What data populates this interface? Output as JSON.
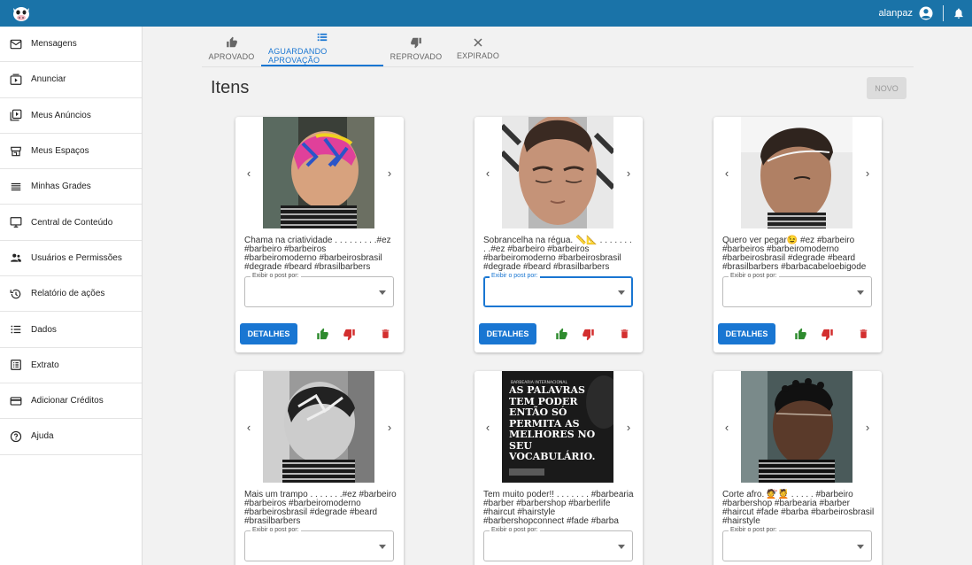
{
  "header": {
    "username": "alanpaz",
    "brand_color": "#1a73a8"
  },
  "sidebar": {
    "items": [
      {
        "label": "Mensagens",
        "icon": "mail-icon"
      },
      {
        "label": "Anunciar",
        "icon": "play-folder-icon"
      },
      {
        "label": "Meus Anúncios",
        "icon": "video-library-icon"
      },
      {
        "label": "Meus Espaços",
        "icon": "store-icon"
      },
      {
        "label": "Minhas Grades",
        "icon": "list-lines-icon"
      },
      {
        "label": "Central de Conteúdo",
        "icon": "monitor-icon"
      },
      {
        "label": "Usuários e Permissões",
        "icon": "users-icon"
      },
      {
        "label": "Relatório de ações",
        "icon": "history-icon"
      },
      {
        "label": "Dados",
        "icon": "bullet-list-icon"
      },
      {
        "label": "Extrato",
        "icon": "receipt-icon"
      },
      {
        "label": "Adicionar Créditos",
        "icon": "credit-card-icon"
      },
      {
        "label": "Ajuda",
        "icon": "help-icon"
      }
    ]
  },
  "tabs": [
    {
      "label": "APROVADO",
      "icon": "thumb-up-icon"
    },
    {
      "label": "AGUARDANDO APROVAÇÃO",
      "icon": "list-icon",
      "active": true
    },
    {
      "label": "REPROVADO",
      "icon": "thumb-down-icon"
    },
    {
      "label": "EXPIRADO",
      "icon": "close-icon"
    }
  ],
  "main": {
    "title": "Itens",
    "new_button": "NOVO"
  },
  "cards": [
    {
      "caption": "Chama na criatividade . . . . . . . . .#ez #barbeiro #barbeiros #barbeiromoderno #barbeirosbrasil #degrade #beard #brasilbarbers",
      "select_label": "Exibir o post por:",
      "details": "DETALHES",
      "focused": false
    },
    {
      "caption": "Sobrancelha na régua. 📏📐 . . . . . . . . .#ez #barbeiro #barbeiros #barbeiromoderno #barbeirosbrasil #degrade #beard #brasilbarbers",
      "select_label": "Exibir o post por:",
      "details": "DETALHES",
      "focused": true
    },
    {
      "caption": "Quero ver pegar😉 #ez #barbeiro #barbeiros #barbeiromoderno #barbeirosbrasil #degrade #beard #brasilbarbers #barbacabeloebigode",
      "select_label": "Exibir o post por:",
      "details": "DETALHES",
      "focused": false
    },
    {
      "caption": "Mais um trampo . . . . . . .#ez #barbeiro #barbeiros #barbeiromoderno #barbeirosbrasil #degrade #beard #brasilbarbers",
      "select_label": "Exibir o post por:",
      "details": "DETALHES",
      "focused": false
    },
    {
      "caption": "Tem muito poder!! . . . . . . . #barbearia #barber #barbershop #barberlife #haircut #hairstyle #barbershopconnect #fade #barba",
      "select_label": "Exibir o post por:",
      "details": "DETALHES",
      "focused": false,
      "image_text": {
        "brand": "BARBEARIA INTERNACIONAL",
        "headline": "AS PALAVRAS TEM PODER ENTÃO SÓ PERMITA AS MELHORES NO SEU VOCABULÁRIO."
      }
    },
    {
      "caption": "Corte afro. 💇💆 . . . . . #barbeiro #barbershop #barbearia #barber #haircut #fade #barba #barbeirosbrasil #hairstyle",
      "select_label": "Exibir o post por:",
      "details": "DETALHES",
      "focused": false
    }
  ]
}
